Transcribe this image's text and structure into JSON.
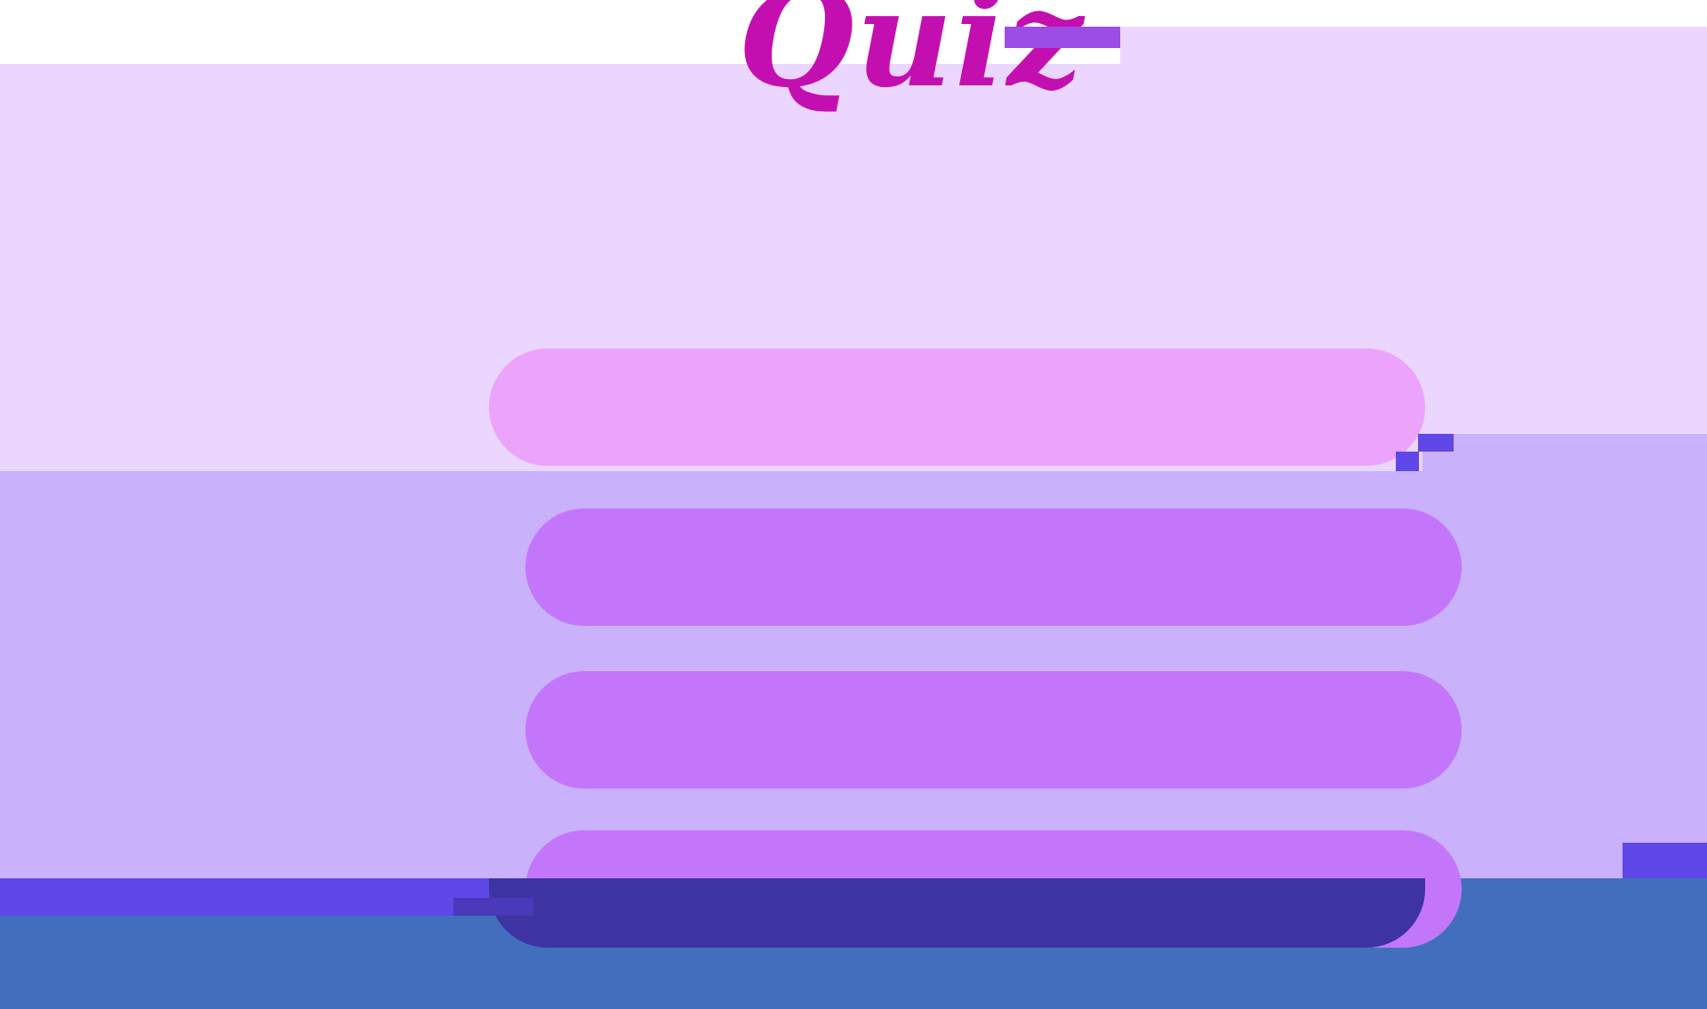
{
  "title": "Quiz",
  "answers": [
    {
      "label": ""
    },
    {
      "label": ""
    },
    {
      "label": ""
    },
    {
      "label": ""
    }
  ],
  "colors": {
    "title": "#c40fb0",
    "background_lavender": "#ead6ff",
    "background_lilac": "#c9b1fb",
    "background_blue": "#426fbd",
    "answer_highlight": "#eba3fb",
    "answer_default": "#c476fb"
  }
}
